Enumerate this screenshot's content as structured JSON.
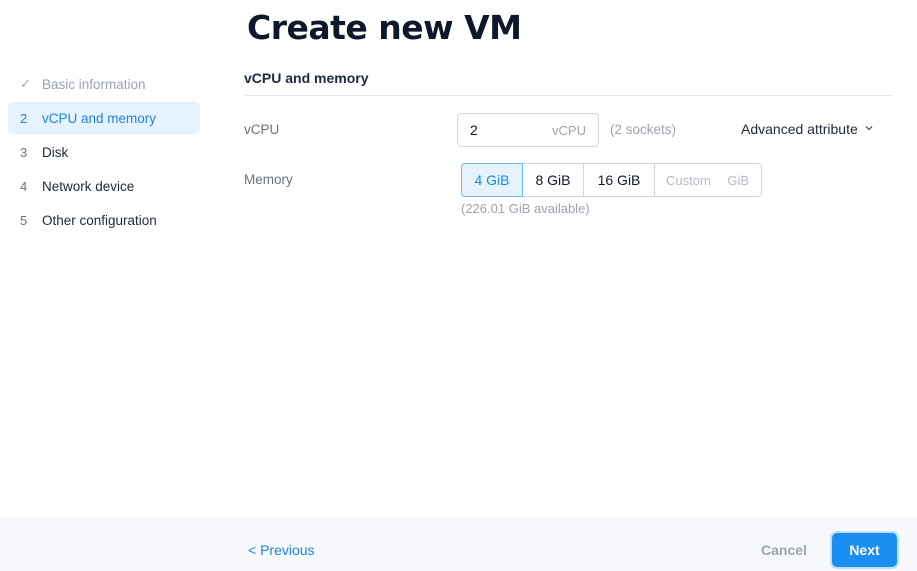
{
  "page": {
    "title": "Create new VM"
  },
  "sidebar": {
    "steps": [
      {
        "marker": "✓",
        "label": "Basic information",
        "state": "done"
      },
      {
        "marker": "2",
        "label": "vCPU and memory",
        "state": "active"
      },
      {
        "marker": "3",
        "label": "Disk",
        "state": "pending"
      },
      {
        "marker": "4",
        "label": "Network device",
        "state": "pending"
      },
      {
        "marker": "5",
        "label": "Other configuration",
        "state": "pending"
      }
    ]
  },
  "section": {
    "title": "vCPU and memory",
    "vcpu": {
      "label": "vCPU",
      "value": "2",
      "unit": "vCPU",
      "sockets_hint": "(2 sockets)"
    },
    "advanced_attribute": {
      "label": "Advanced attribute",
      "icon": "chevron-down-icon"
    },
    "memory": {
      "label": "Memory",
      "options": [
        "4 GiB",
        "8 GiB",
        "16 GiB"
      ],
      "selected": "4 GiB",
      "custom_placeholder": "Custom",
      "custom_unit": "GiB",
      "available": "(226.01 GiB available)"
    }
  },
  "footer": {
    "previous_label": "< Previous",
    "cancel_label": "Cancel",
    "next_label": "Next"
  },
  "colors": {
    "accent": "#1b8ef2",
    "active_bg": "#e6f3fd",
    "active_text": "#1b86dc"
  }
}
